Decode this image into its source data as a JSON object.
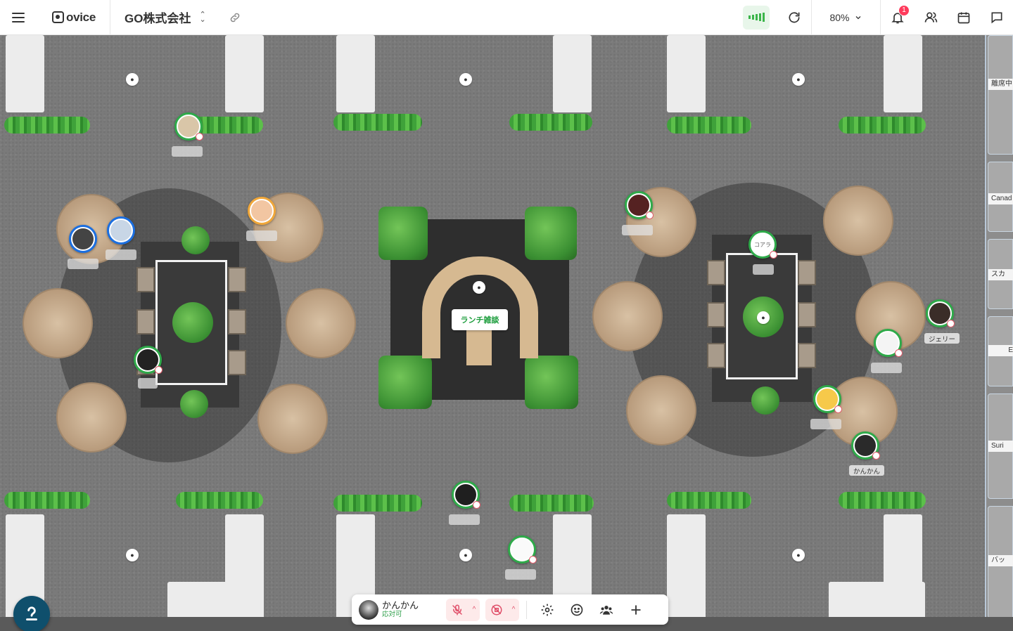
{
  "header": {
    "brand": "ovice",
    "org_name": "GO株式会社",
    "zoom": "80%",
    "notification_count": "1"
  },
  "map": {
    "room_name": "ランチ雑談",
    "users": [
      {
        "name": "ジェリー"
      },
      {
        "name": "かんかん"
      }
    ],
    "avatar_texts": {
      "koala": "コアラ"
    }
  },
  "side_rooms": {
    "labels": [
      "離席中",
      "Canad",
      "スカ",
      "E",
      "Suri",
      "バッ"
    ]
  },
  "toolbar": {
    "user_name": "かんかん",
    "user_status": "応対可"
  },
  "colors": {
    "accent_green": "#2faa4a",
    "mute_red": "#e0506a",
    "notif_red": "#ff3b5c",
    "help_button": "#0f4f6c"
  }
}
